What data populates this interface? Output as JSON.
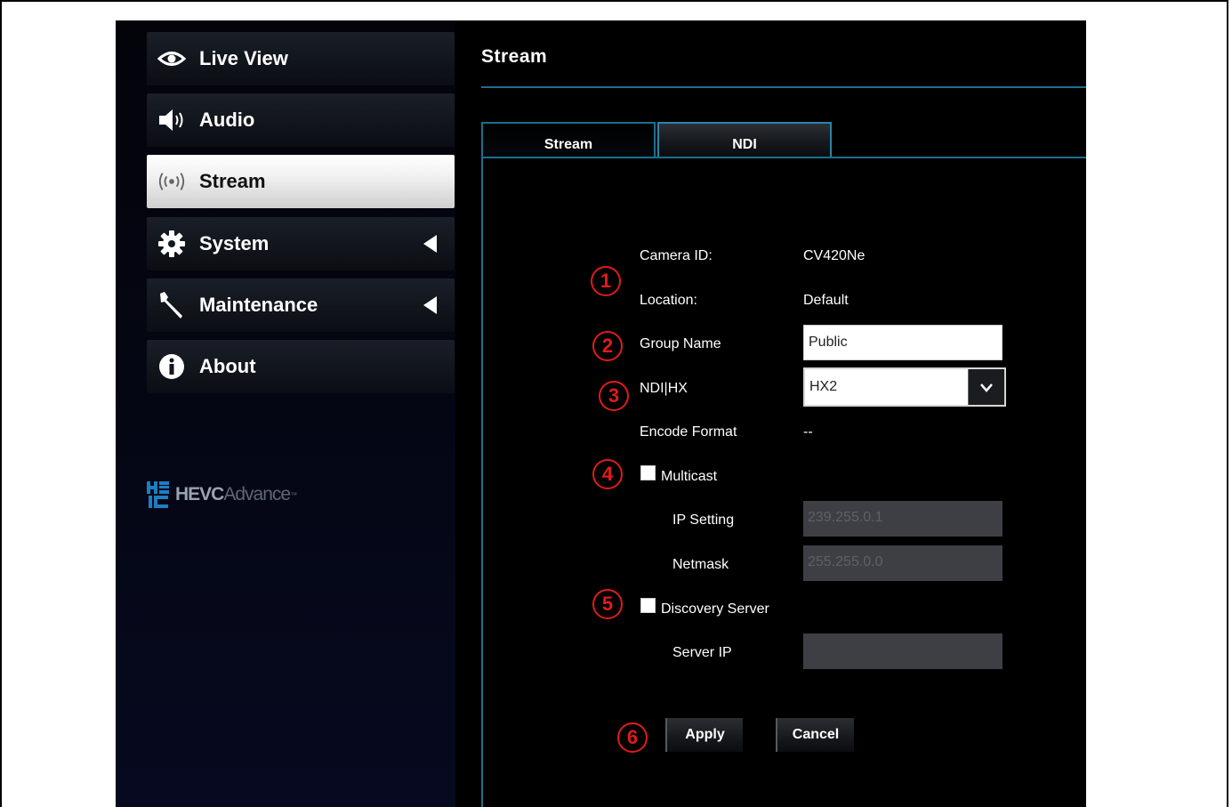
{
  "nav": {
    "items": [
      {
        "label": "Live View",
        "icon": "eye-icon"
      },
      {
        "label": "Audio",
        "icon": "speaker-icon"
      },
      {
        "label": "Stream",
        "icon": "broadcast-icon",
        "active": true
      },
      {
        "label": "System",
        "icon": "gear-icon",
        "has_submenu": true
      },
      {
        "label": "Maintenance",
        "icon": "wrench-icon",
        "has_submenu": true
      },
      {
        "label": "About",
        "icon": "info-icon"
      }
    ]
  },
  "logo": {
    "prefix": "HEVC",
    "suffix": "Advance",
    "tm": "™"
  },
  "page": {
    "title": "Stream"
  },
  "tabs": [
    {
      "label": "Stream"
    },
    {
      "label": "NDI",
      "active": true
    }
  ],
  "form": {
    "camera_id_label": "Camera ID:",
    "camera_id_value": "CV420Ne",
    "location_label": "Location:",
    "location_value": "Default",
    "group_name_label": "Group Name",
    "group_name_value": "Public",
    "ndi_hx_label": "NDI|HX",
    "ndi_hx_value": "HX2",
    "encode_format_label": "Encode Format",
    "encode_format_value": "--",
    "multicast_label": "Multicast",
    "multicast_checked": false,
    "ip_setting_label": "IP Setting",
    "ip_setting_placeholder": "239.255.0.1",
    "netmask_label": "Netmask",
    "netmask_placeholder": "255.255.0.0",
    "discovery_label": "Discovery Server",
    "discovery_checked": false,
    "server_ip_label": "Server IP",
    "server_ip_value": "",
    "apply_label": "Apply",
    "cancel_label": "Cancel"
  },
  "callouts": [
    "1",
    "2",
    "3",
    "4",
    "5",
    "6"
  ],
  "colors": {
    "accent": "#1e6e8d",
    "callout": "#e01b1b",
    "background": "#000000"
  }
}
